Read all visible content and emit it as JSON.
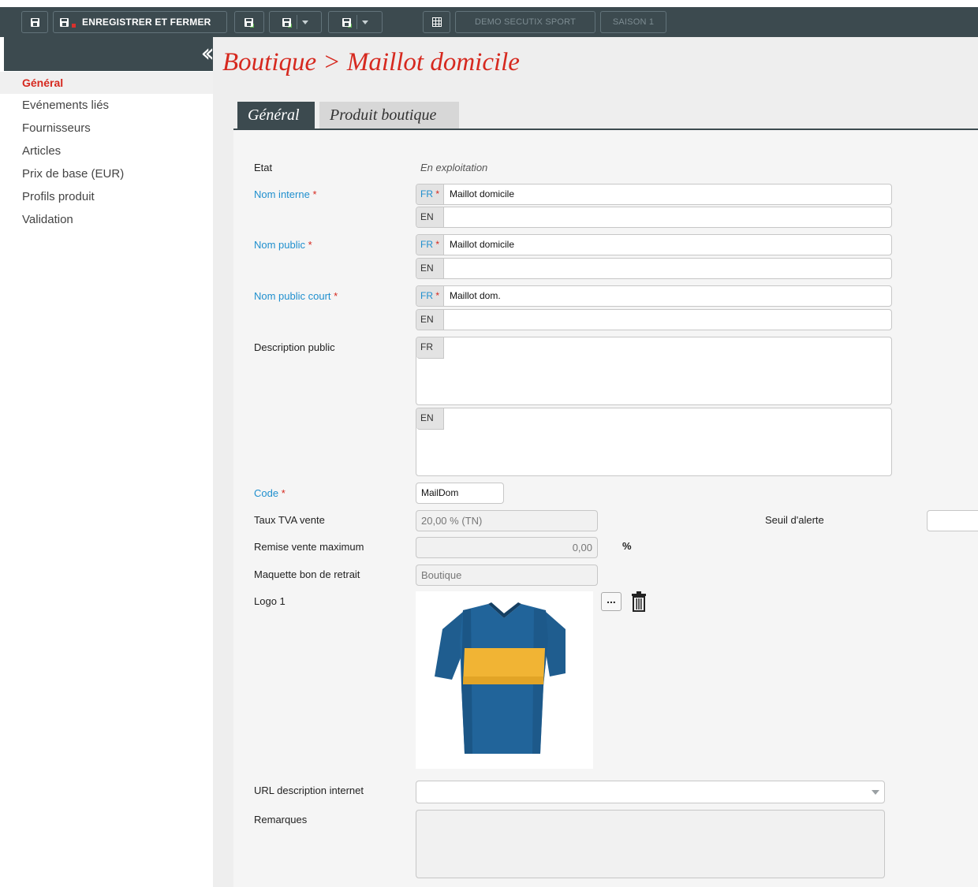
{
  "toolbar": {
    "save_close_label": "ENREGISTRER ET FERMER",
    "org_label": "DEMO SECUTIX SPORT",
    "season_label": "SAISON 1"
  },
  "sidebar": {
    "items": [
      {
        "label": "Général",
        "active": true
      },
      {
        "label": "Evénements liés"
      },
      {
        "label": "Fournisseurs"
      },
      {
        "label": "Articles"
      },
      {
        "label": "Prix de base (EUR)"
      },
      {
        "label": "Profils produit"
      },
      {
        "label": "Validation"
      }
    ]
  },
  "page": {
    "title": "Boutique > Maillot domicile"
  },
  "tabs": [
    {
      "label": "Général",
      "active": true
    },
    {
      "label": "Produit boutique"
    }
  ],
  "form": {
    "etat": {
      "label": "Etat",
      "value": "En exploitation"
    },
    "nom_interne": {
      "label": "Nom interne",
      "fr": "Maillot domicile",
      "en": ""
    },
    "nom_public": {
      "label": "Nom public",
      "fr": "Maillot domicile",
      "en": ""
    },
    "nom_public_court": {
      "label": "Nom public court",
      "fr": "Maillot dom.",
      "en": ""
    },
    "description_public": {
      "label": "Description public",
      "fr": "",
      "en": ""
    },
    "lang_fr": "FR",
    "lang_en": "EN",
    "required_mark": "*",
    "code": {
      "label": "Code",
      "value": "MailDom"
    },
    "taux_tva": {
      "label": "Taux TVA vente",
      "value": "20,00 % (TN)"
    },
    "seuil_alerte": {
      "label": "Seuil d'alerte",
      "value": ""
    },
    "remise_max": {
      "label": "Remise vente maximum",
      "value": "0,00",
      "unit": "%"
    },
    "maquette": {
      "label": "Maquette bon de retrait",
      "value": "Boutique"
    },
    "logo": {
      "label": "Logo 1",
      "browse_label": "..."
    },
    "url_description": {
      "label": "URL description internet",
      "value": ""
    },
    "remarques": {
      "label": "Remarques",
      "value": ""
    }
  },
  "colors": {
    "accent_red": "#d6291f",
    "toolbar_bg": "#3c4a4f",
    "required_blue": "#1f8fce",
    "shirt_blue": "#1f5d8f",
    "shirt_yellow": "#f1b434"
  }
}
